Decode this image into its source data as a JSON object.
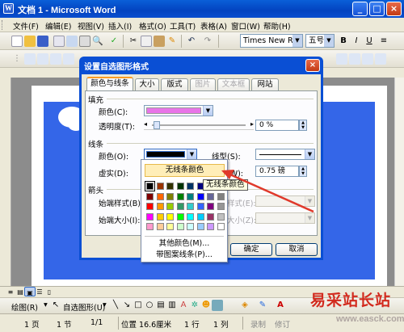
{
  "window": {
    "title": "文档 1 - Microsoft Word",
    "app_icon": "W"
  },
  "menu": [
    "文件(F)",
    "编辑(E)",
    "视图(V)",
    "插入(I)",
    "格式(O)",
    "工具(T)",
    "表格(A)",
    "窗口(W)",
    "帮助(H)"
  ],
  "formatting": {
    "font": "Times New Roma",
    "size": "五号"
  },
  "dialog": {
    "title": "设置自选图形格式",
    "close": "×",
    "tabs": [
      {
        "label": "颜色与线条",
        "active": true,
        "disabled": false
      },
      {
        "label": "大小",
        "active": false,
        "disabled": false
      },
      {
        "label": "版式",
        "active": false,
        "disabled": false
      },
      {
        "label": "图片",
        "active": false,
        "disabled": true
      },
      {
        "label": "文本框",
        "active": false,
        "disabled": true
      },
      {
        "label": "网站",
        "active": false,
        "disabled": false
      }
    ],
    "fill": {
      "section": "填充",
      "color_label": "颜色(C):",
      "color_value": "#e875e8",
      "transparency_label": "透明度(T):",
      "transparency_value": "0 %"
    },
    "line": {
      "section": "线条",
      "color_label": "颜色(O):",
      "color_value": "#000000",
      "style_label": "线型(S):",
      "dash_label": "虚实(D):",
      "weight_label": "粗细(W):",
      "weight_value": "0.75 磅"
    },
    "arrows": {
      "section": "箭头",
      "begin_style_label": "始端样式(B):",
      "end_style_label": "末端样式(E):",
      "begin_size_label": "始端大小(I):",
      "end_size_label": "末端大小(Z):"
    },
    "ok": "确定",
    "cancel": "取消"
  },
  "color_dropdown": {
    "no_line": "无线条颜色",
    "more_colors": "其他颜色(M)...",
    "patterned_lines": "带图案线条(P)...",
    "tooltip": "无线条颜色",
    "palette": [
      "#000000",
      "#993300",
      "#333300",
      "#003300",
      "#003366",
      "#000080",
      "#333399",
      "#333333",
      "#800000",
      "#ff6600",
      "#808000",
      "#008000",
      "#008080",
      "#0000ff",
      "#666699",
      "#808080",
      "#ff0000",
      "#ff9900",
      "#99cc00",
      "#339966",
      "#33cccc",
      "#3366ff",
      "#800080",
      "#969696",
      "#ff00ff",
      "#ffcc00",
      "#ffff00",
      "#00ff00",
      "#00ffff",
      "#00ccff",
      "#993366",
      "#c0c0c0",
      "#ff99cc",
      "#ffcc99",
      "#ffff99",
      "#ccffcc",
      "#ccffff",
      "#99ccff",
      "#cc99ff",
      "#ffffff"
    ]
  },
  "drawing_toolbar": {
    "draw": "绘图(R)",
    "autoshapes": "自选图形(U)"
  },
  "status": {
    "page": "1 页",
    "section": "1 节",
    "pages": "1/1",
    "position": "位置 16.6厘米",
    "line": "1 行",
    "col": "1 列",
    "rec": "录制",
    "trk": "修订"
  },
  "watermark": {
    "text": "易采站长站",
    "url": "www.easck.com"
  },
  "colors": {
    "shape_blue": "#3466e8",
    "title_blue": "#0a4fd4",
    "annotation_red": "#e0392b"
  }
}
